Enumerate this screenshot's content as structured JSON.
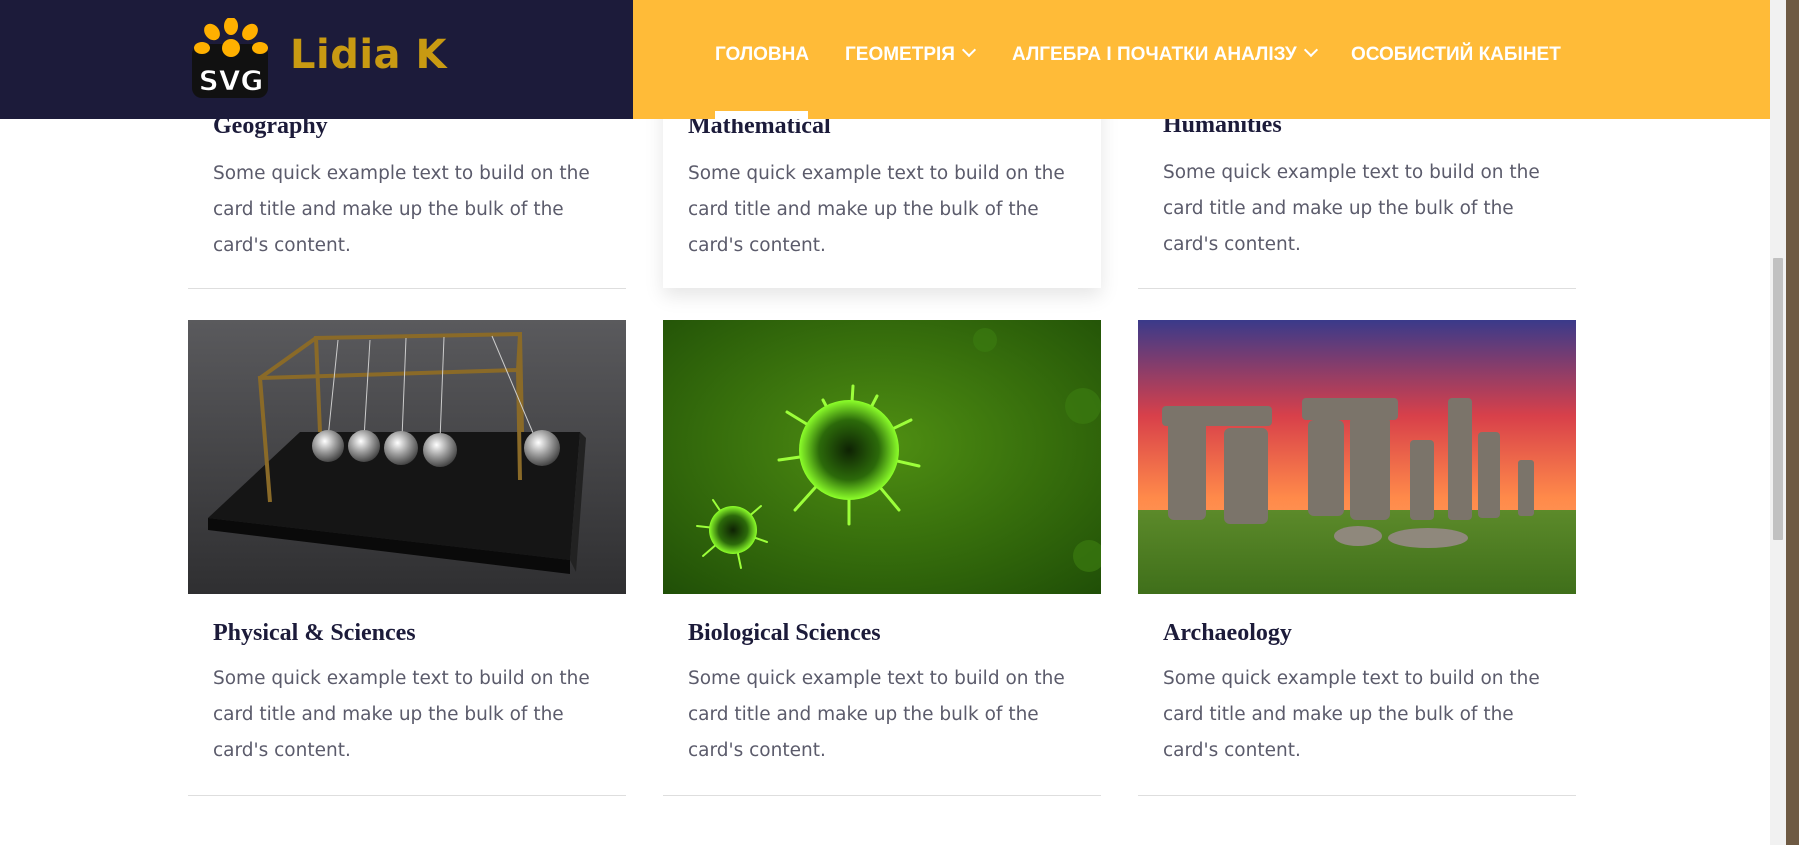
{
  "brand": {
    "logo_text": "SVG",
    "name": "Lidia K"
  },
  "nav": {
    "items": [
      {
        "label": "ГОЛОВНА",
        "active": true,
        "dropdown": false
      },
      {
        "label": "ГЕОМЕТРІЯ",
        "active": false,
        "dropdown": true
      },
      {
        "label": "АЛГЕБРА І ПОЧАТКИ АНАЛІЗУ",
        "active": false,
        "dropdown": true
      },
      {
        "label": "ОСОБИСТИЙ КАБІНЕТ",
        "active": false,
        "dropdown": false
      }
    ]
  },
  "cards_top": [
    {
      "title": "Geography",
      "text": "Some quick example text to build on the card title and make up the bulk of the card's content."
    },
    {
      "title": "Mathematical",
      "text": "Some quick example text to build on the card title and make up the bulk of the card's content."
    },
    {
      "title": "Humanities",
      "text": "Some quick example text to build on the card title and make up the bulk of the card's content."
    }
  ],
  "cards_bottom": [
    {
      "title": "Physical & Sciences",
      "text": "Some quick example text to build on the card title and make up the bulk of the card's content.",
      "image": "newtons-cradle-image"
    },
    {
      "title": "Biological Sciences",
      "text": "Some quick example text to build on the card title and make up the bulk of the card's content.",
      "image": "virus-image"
    },
    {
      "title": "Archaeology",
      "text": "Some quick example text to build on the card title and make up the bulk of the card's content.",
      "image": "stonehenge-image"
    }
  ],
  "colors": {
    "header_dark": "#1c1b3a",
    "header_accent": "#ffbb38",
    "title_text": "#1c1b3a",
    "body_text": "#5b5b6b"
  }
}
